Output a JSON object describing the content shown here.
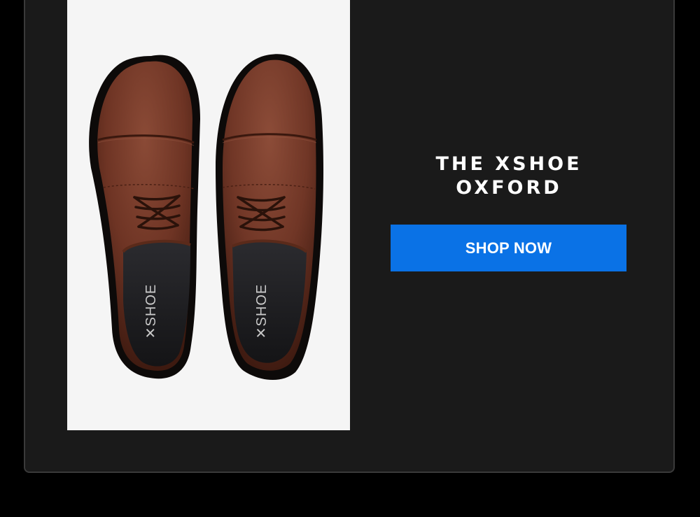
{
  "product": {
    "title_line1": "THE XSHOE",
    "title_line2": "OXFORD",
    "image": {
      "subject": "pair-of-brown-leather-oxford-shoes-top-view",
      "insole_brand": "SHOE"
    }
  },
  "cta": {
    "label": "SHOP NOW"
  },
  "colors": {
    "page_background": "#000000",
    "card_background": "#1a1a1a",
    "card_border": "#3a3a3a",
    "photo_background": "#f5f5f5",
    "accent": "#0a72e6",
    "title_text": "#ffffff",
    "leather": "#6e3424"
  }
}
